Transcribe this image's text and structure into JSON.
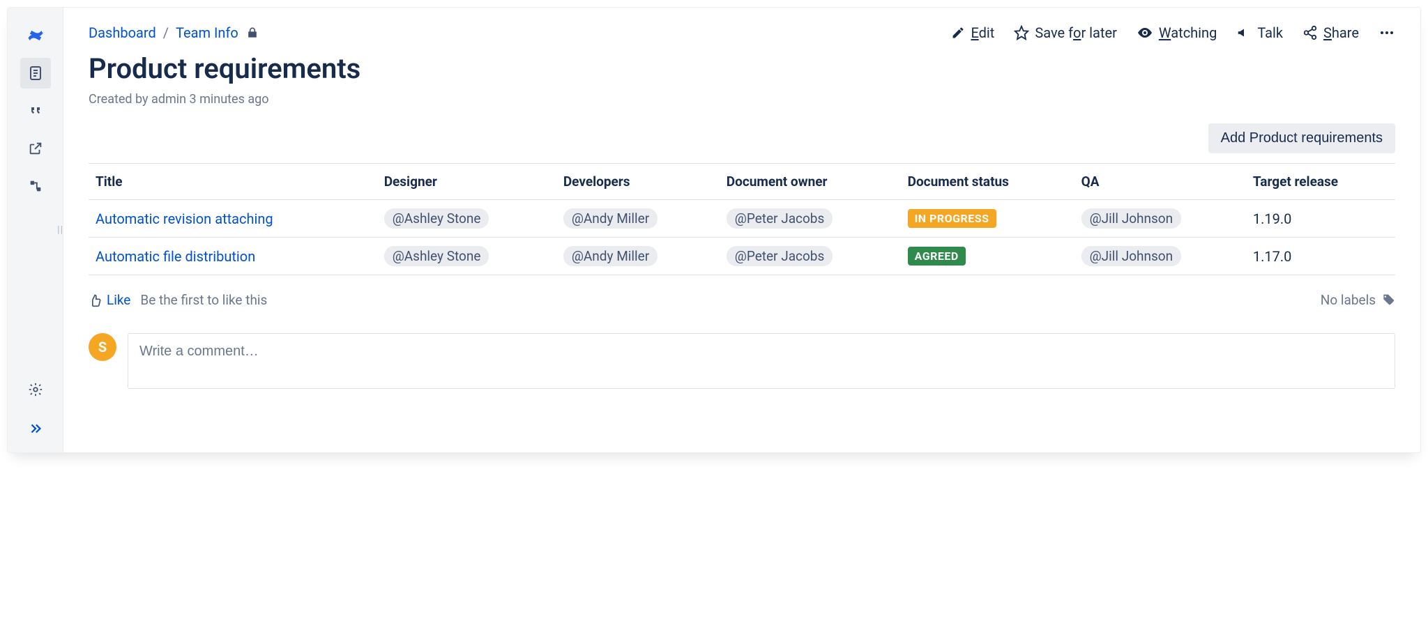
{
  "breadcrumbs": {
    "dashboard": "Dashboard",
    "team_info": "Team Info"
  },
  "title": "Product requirements",
  "meta": "Created by admin 3 minutes ago",
  "actions": {
    "edit": "dit",
    "save": "Save f",
    "save2": "r later",
    "watching": "atching",
    "talk": "Talk",
    "share": "hare"
  },
  "add_button": "Add Product requirements",
  "columns": {
    "title": "Title",
    "designer": "Designer",
    "devs": "Developers",
    "owner": "Document owner",
    "status": "Document status",
    "qa": "QA",
    "target": "Target release"
  },
  "rows": [
    {
      "title": "Automatic revision attaching",
      "designer": "@Ashley Stone",
      "devs": "@Andy Miller",
      "owner": "@Peter Jacobs",
      "status_text": "IN PROGRESS",
      "status_class": "in-progress",
      "qa": "@Jill Johnson",
      "target": "1.19.0"
    },
    {
      "title": "Automatic file distribution",
      "designer": "@Ashley Stone",
      "devs": "@Andy Miller",
      "owner": "@Peter Jacobs",
      "status_text": "AGREED",
      "status_class": "agreed",
      "qa": "@Jill Johnson",
      "target": "1.17.0"
    }
  ],
  "like_label": "Like",
  "like_hint": "Be the first to like this",
  "no_labels": "No labels",
  "comment_placeholder": "Write a comment…",
  "avatar_initial": "S"
}
